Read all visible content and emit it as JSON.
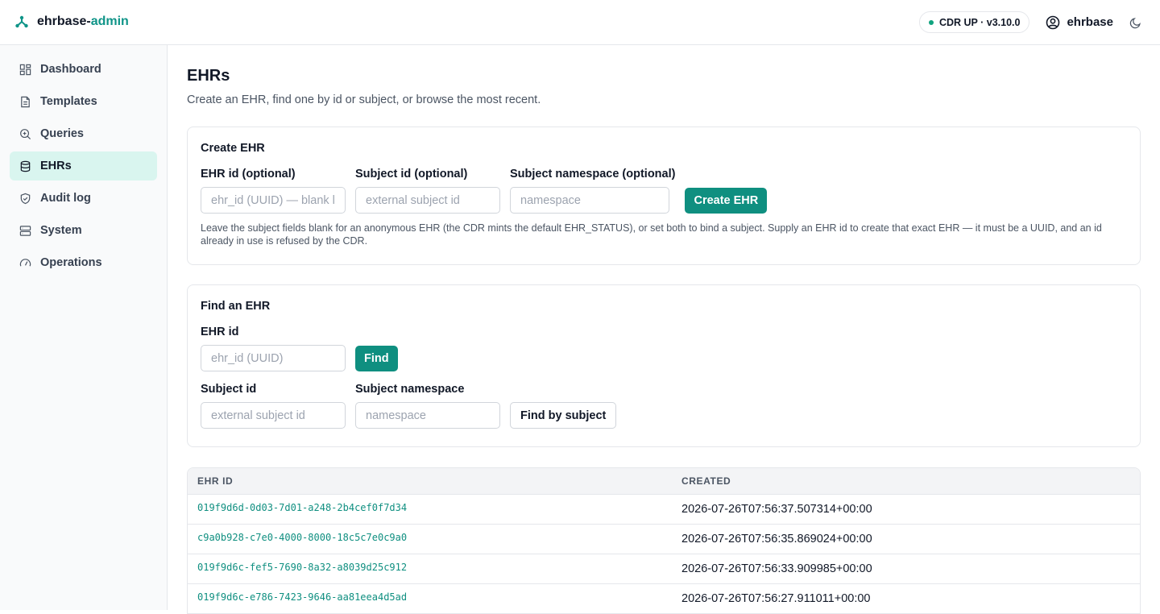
{
  "brand": {
    "name_prefix": "ehrbase-",
    "name_accent": "admin"
  },
  "header": {
    "status": "CDR UP · v3.10.0",
    "user": "ehrbase"
  },
  "sidebar": {
    "items": [
      {
        "label": "Dashboard",
        "icon": "dashboard-icon"
      },
      {
        "label": "Templates",
        "icon": "templates-icon"
      },
      {
        "label": "Queries",
        "icon": "queries-icon"
      },
      {
        "label": "EHRs",
        "icon": "database-icon",
        "active": true
      },
      {
        "label": "Audit log",
        "icon": "shield-icon"
      },
      {
        "label": "System",
        "icon": "server-icon"
      },
      {
        "label": "Operations",
        "icon": "gauge-icon"
      }
    ]
  },
  "page": {
    "title": "EHRs",
    "subtitle": "Create an EHR, find one by id or subject, or browse the most recent."
  },
  "create": {
    "title": "Create EHR",
    "ehr_id_label": "EHR id (optional)",
    "ehr_id_placeholder": "ehr_id (UUID) — blank lets the CDR assign",
    "subject_id_label": "Subject id (optional)",
    "subject_id_placeholder": "external subject id",
    "namespace_label": "Subject namespace (optional)",
    "namespace_placeholder": "namespace",
    "button": "Create EHR",
    "hint": "Leave the subject fields blank for an anonymous EHR (the CDR mints the default EHR_STATUS), or set both to bind a subject. Supply an EHR id to create that exact EHR — it must be a UUID, and an id already in use is refused by the CDR."
  },
  "find": {
    "title": "Find an EHR",
    "ehr_id_label": "EHR id",
    "ehr_id_placeholder": "ehr_id (UUID)",
    "find_button": "Find",
    "subject_id_label": "Subject id",
    "subject_id_placeholder": "external subject id",
    "namespace_label": "Subject namespace",
    "namespace_placeholder": "namespace",
    "subject_button": "Find by subject"
  },
  "table": {
    "headers": {
      "ehr_id": "EHR ID",
      "created": "CREATED"
    },
    "rows": [
      {
        "ehr_id": "019f9d6d-0d03-7d01-a248-2b4cef0f7d34",
        "created": "2026-07-26T07:56:37.507314+00:00"
      },
      {
        "ehr_id": "c9a0b928-c7e0-4000-8000-18c5c7e0c9a0",
        "created": "2026-07-26T07:56:35.869024+00:00"
      },
      {
        "ehr_id": "019f9d6c-fef5-7690-8a32-a8039d25c912",
        "created": "2026-07-26T07:56:33.909985+00:00"
      },
      {
        "ehr_id": "019f9d6c-e786-7423-9646-aa81eea4d5ad",
        "created": "2026-07-26T07:56:27.911011+00:00"
      }
    ]
  },
  "colors": {
    "accent": "#0f8f80",
    "active_nav_bg": "#d9f5ef",
    "status_dot": "#10a37f"
  }
}
